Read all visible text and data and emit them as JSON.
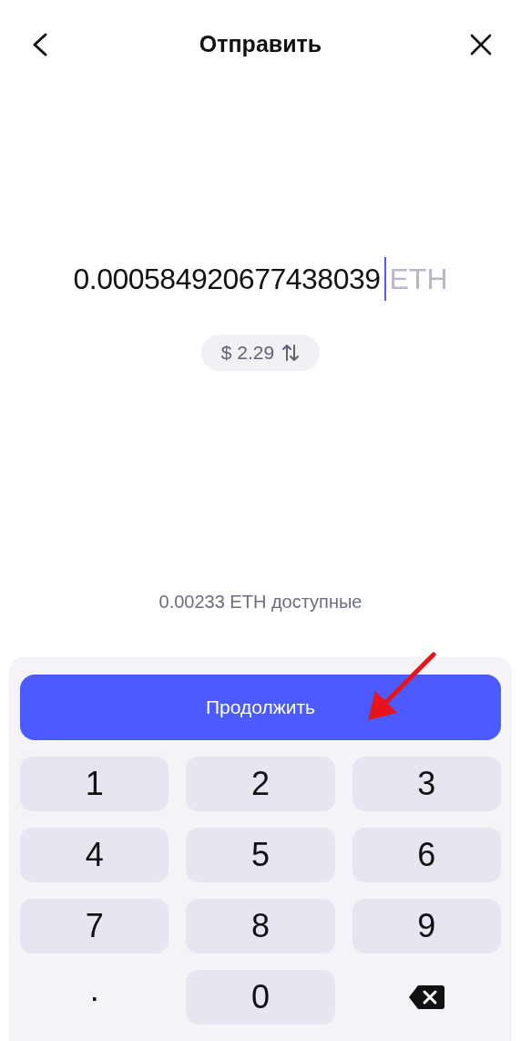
{
  "header": {
    "title": "Отправить"
  },
  "amount": {
    "value": "0.000584920677438039",
    "currency": "ETH"
  },
  "fiat": {
    "value": "$ 2.29"
  },
  "balance": "0.00233 ETH доступные",
  "continue_button": "Продолжить",
  "keypad": [
    {
      "kind": "key",
      "label": "1"
    },
    {
      "kind": "key",
      "label": "2"
    },
    {
      "kind": "key",
      "label": "3"
    },
    {
      "kind": "key",
      "label": "4"
    },
    {
      "kind": "key",
      "label": "5"
    },
    {
      "kind": "key",
      "label": "6"
    },
    {
      "kind": "key",
      "label": "7"
    },
    {
      "kind": "key",
      "label": "8"
    },
    {
      "kind": "key",
      "label": "9"
    },
    {
      "kind": "plain",
      "label": "."
    },
    {
      "kind": "key",
      "label": "0"
    },
    {
      "kind": "backspace"
    }
  ]
}
